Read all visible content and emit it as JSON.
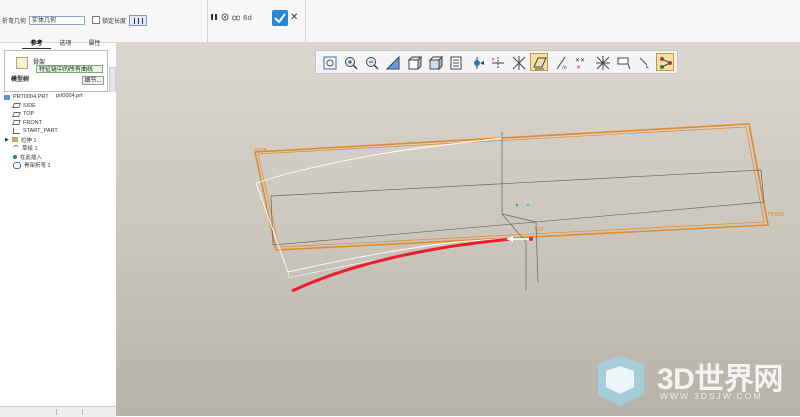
{
  "toolbar": {
    "fold_geometry_label": "折弯几何",
    "fold_geometry_value": "实体几何",
    "lock_length_label": "锁定长度",
    "pause_icon": "pause-icon",
    "confirm_icon": "check-icon",
    "cancel_label": "✕"
  },
  "tabs": [
    "参考",
    "选项",
    "属性"
  ],
  "panel": {
    "section_label": "骨架",
    "value": "特征链中的所有曲线",
    "detail_button": "细节...",
    "model_tree_label": "模型树"
  },
  "tree": {
    "items": [
      {
        "label": "PRT0004.PRT",
        "icon": "part-icon"
      },
      {
        "label": "SIDE",
        "icon": "plane-icon"
      },
      {
        "label": "TOP",
        "icon": "plane-icon"
      },
      {
        "label": "FRONT",
        "icon": "plane-icon"
      },
      {
        "label": "START_PART",
        "icon": "csys-icon"
      },
      {
        "label": "拉伸 1",
        "icon": "extrude-icon"
      },
      {
        "label": "草绘 1",
        "icon": "sketch-icon"
      },
      {
        "label": "在此插入",
        "icon": "insert-icon"
      },
      {
        "label": "骨架折弯 1",
        "icon": "spinal-bend-icon"
      }
    ],
    "file_name": "prt0004.prt"
  },
  "viewport": {
    "plane_labels": [
      "SIDE",
      "TOP",
      "FRONT"
    ],
    "view_tools": [
      "refit-icon",
      "zoom-in-icon",
      "zoom-out-icon",
      "repaint-icon",
      "display-style-icon",
      "saved-views-icon",
      "datum-display-icon",
      "axis-display-icon",
      "plane-display-icon",
      "point-display-icon",
      "csys-display-icon",
      "annotation-display-icon",
      "spin-center-icon",
      "appearance-icon"
    ]
  },
  "watermark": {
    "brand": "3D世界网",
    "url": "WWW.3DSJW.COM"
  },
  "colors": {
    "accent": "#2b86d6",
    "part_edge": "#e0892a",
    "bend_curve": "#ee1c2e",
    "viewport_bg": "#d0ccc3"
  }
}
